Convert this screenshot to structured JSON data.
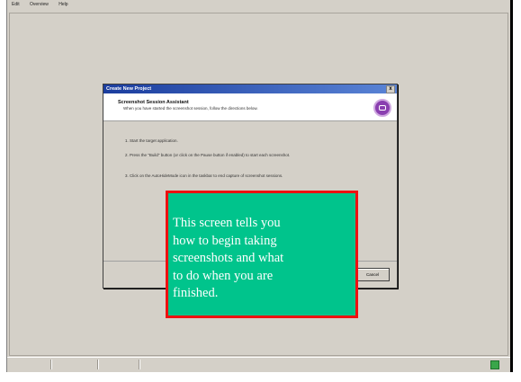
{
  "menubar": {
    "items": [
      "Edit",
      "Overview",
      "Help"
    ]
  },
  "dialog": {
    "title": "Create New Project",
    "close_label": "x",
    "heading": "Screenshot Session Assistant",
    "subheading": "When you have started the screenshot session, follow the directions below.",
    "steps": [
      "1.  Start the target application.",
      "2.  Press the \"Build\" button (or click on the Pause button if enabled) to start each screenshot.",
      "3.  Click on the AutoHideMode icon in the taskbar to end capture of screenshot sessions."
    ],
    "cancel_label": "Cancel"
  },
  "callout": {
    "lines": [
      "This screen tells you",
      "how to begin taking",
      "screenshots and what",
      "to do when you are",
      "finished."
    ]
  },
  "colors": {
    "callout_fill": "#00c48c",
    "callout_border": "#ee1111",
    "title_bar": "#1b3d9e"
  },
  "icons": {
    "logo": "project-logo-icon",
    "tray": "tray-icon"
  }
}
